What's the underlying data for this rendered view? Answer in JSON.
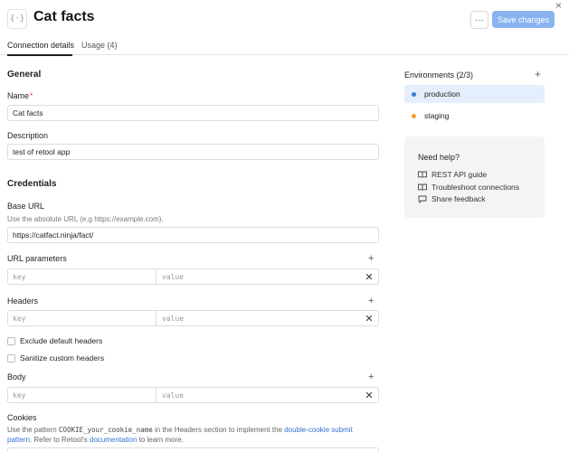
{
  "header": {
    "title": "Cat facts",
    "more_label": "···",
    "save_label": "Save changes",
    "close_label": "×",
    "resource_icon_label": "{·}"
  },
  "tabs": [
    {
      "label": "Connection details",
      "active": true
    },
    {
      "label": "Usage (4)",
      "active": false
    }
  ],
  "general": {
    "title": "General",
    "name_label": "Name",
    "name_required": "*",
    "name_value": "Cat facts",
    "description_label": "Description",
    "description_value": "test of retool app"
  },
  "credentials": {
    "title": "Credentials",
    "base_url_label": "Base URL",
    "base_url_help": "Use the absolute URL (e.g https://example.com).",
    "base_url_value": "https://catfact.ninja/fact/",
    "url_params_label": "URL parameters",
    "headers_label": "Headers",
    "body_label": "Body",
    "key_placeholder": "key",
    "value_placeholder": "value",
    "exclude_default_headers": "Exclude default headers",
    "sanitize_custom_headers": "Sanitize custom headers",
    "cookies_label": "Cookies",
    "cookies_help": {
      "prefix": "Use the pattern ",
      "pattern": "COOKIE_your_cookie_name",
      "middle": " in the Headers section to implement the ",
      "link1": "double-cookie submit pattern",
      "middle2": ". Refer to Retool's ",
      "link2": "documentation",
      "suffix": " to learn more."
    }
  },
  "environments": {
    "title": "Environments (2/3)",
    "add_label": "+",
    "items": [
      {
        "label": "production",
        "color": "#3a7bd5",
        "selected": true
      },
      {
        "label": "staging",
        "color": "#f0a030",
        "selected": false
      }
    ]
  },
  "help": {
    "title": "Need help?",
    "links": [
      {
        "label": "REST API guide",
        "icon": "book-icon"
      },
      {
        "label": "Troubleshoot connections",
        "icon": "book-icon"
      },
      {
        "label": "Share feedback",
        "icon": "chat-icon"
      }
    ]
  },
  "colors": {
    "accent": "#8ab4f0",
    "link": "#3570d4",
    "selected_env_bg": "#e5eefc"
  }
}
